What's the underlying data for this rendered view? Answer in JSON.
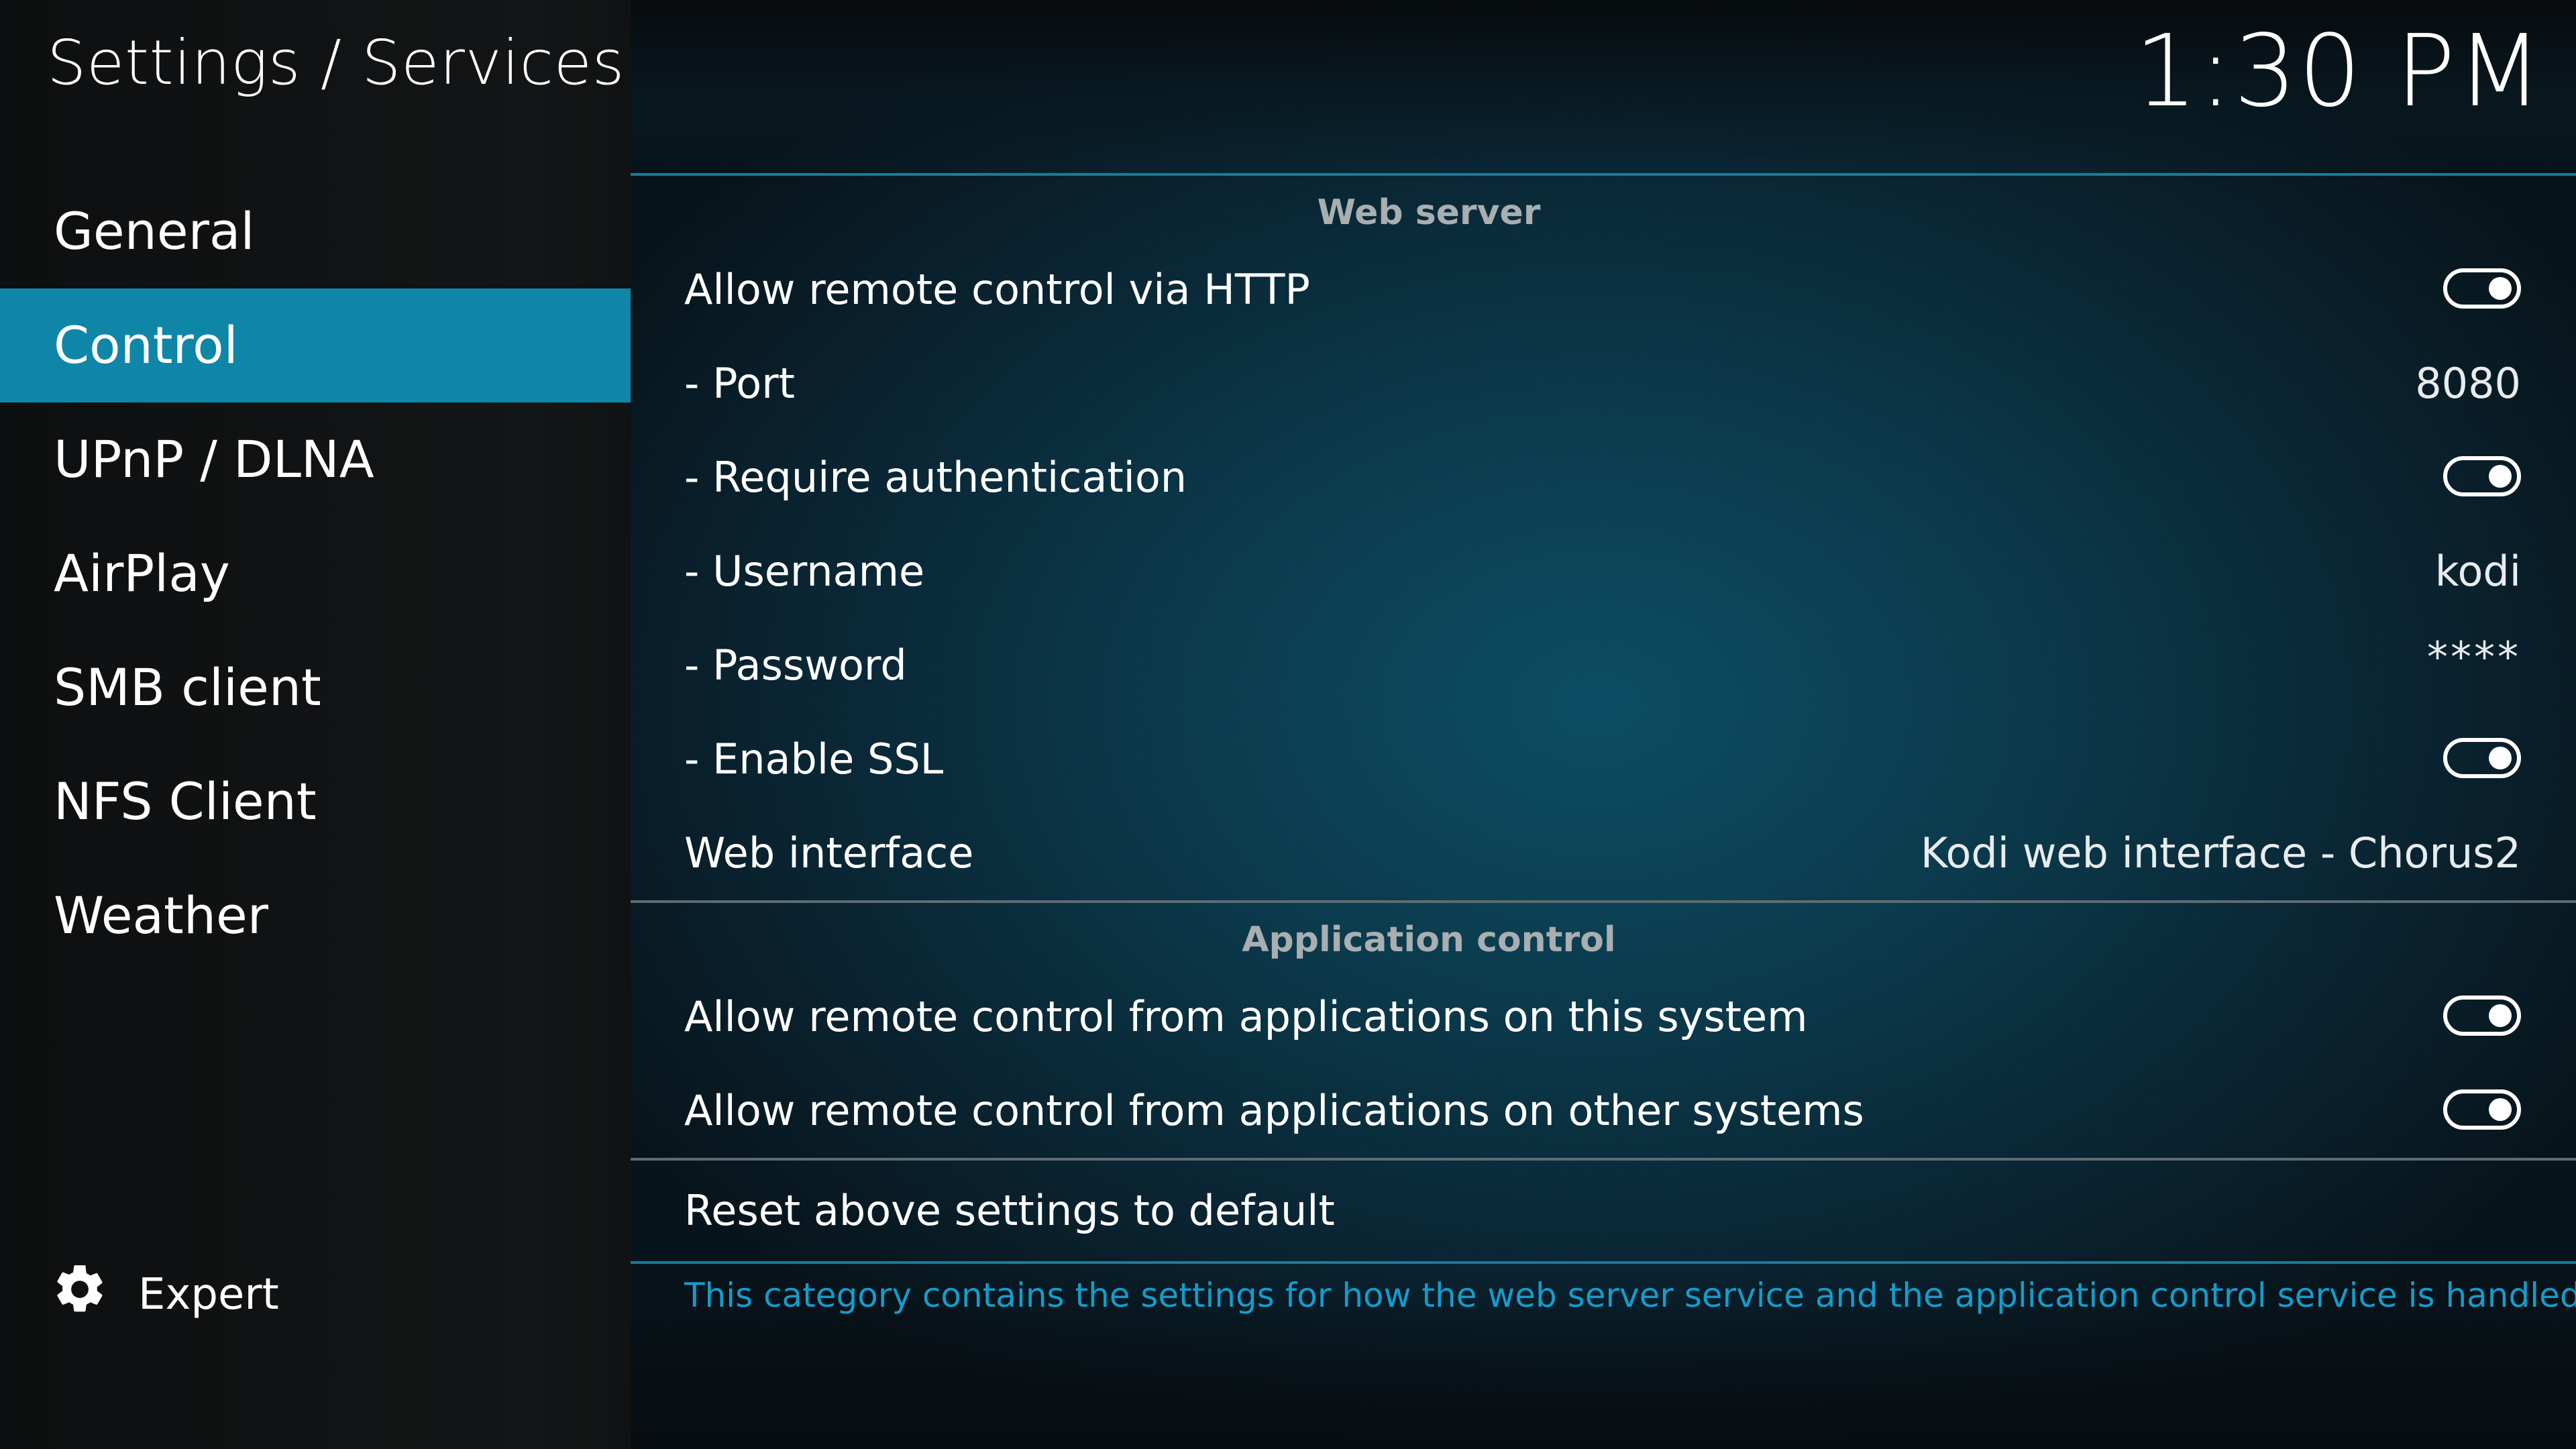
{
  "header": {
    "title": "Settings / Services",
    "clock": "1:30 PM"
  },
  "sidebar": {
    "items": [
      {
        "label": "General",
        "active": false
      },
      {
        "label": "Control",
        "active": true
      },
      {
        "label": "UPnP / DLNA",
        "active": false
      },
      {
        "label": "AirPlay",
        "active": false
      },
      {
        "label": "SMB client",
        "active": false
      },
      {
        "label": "NFS Client",
        "active": false
      },
      {
        "label": "Weather",
        "active": false
      }
    ],
    "expert_label": "Expert",
    "expert_icon": "gear-icon"
  },
  "web_server": {
    "header": "Web server",
    "rows": [
      {
        "label": "Allow remote control via HTTP",
        "type": "toggle",
        "enabled": true
      },
      {
        "label": "- Port",
        "type": "value",
        "value": "8080"
      },
      {
        "label": "- Require authentication",
        "type": "toggle",
        "enabled": true
      },
      {
        "label": "- Username",
        "type": "value",
        "value": "kodi"
      },
      {
        "label": "- Password",
        "type": "value",
        "value": "****"
      },
      {
        "label": "- Enable SSL",
        "type": "toggle",
        "enabled": true
      },
      {
        "label": "Web interface",
        "type": "value",
        "value": "Kodi web interface - Chorus2"
      }
    ]
  },
  "application_control": {
    "header": "Application control",
    "rows": [
      {
        "label": "Allow remote control from applications on this system",
        "type": "toggle",
        "enabled": true
      },
      {
        "label": "Allow remote control from applications on other systems",
        "type": "toggle",
        "enabled": true
      }
    ]
  },
  "reset_label": "Reset above settings to default",
  "description": "This category contains the settings for how the web server service and the application control service is handled.",
  "colors": {
    "accent": "#0f86a8",
    "description_text": "#159ccb",
    "section_header": "#a9aeb0"
  }
}
